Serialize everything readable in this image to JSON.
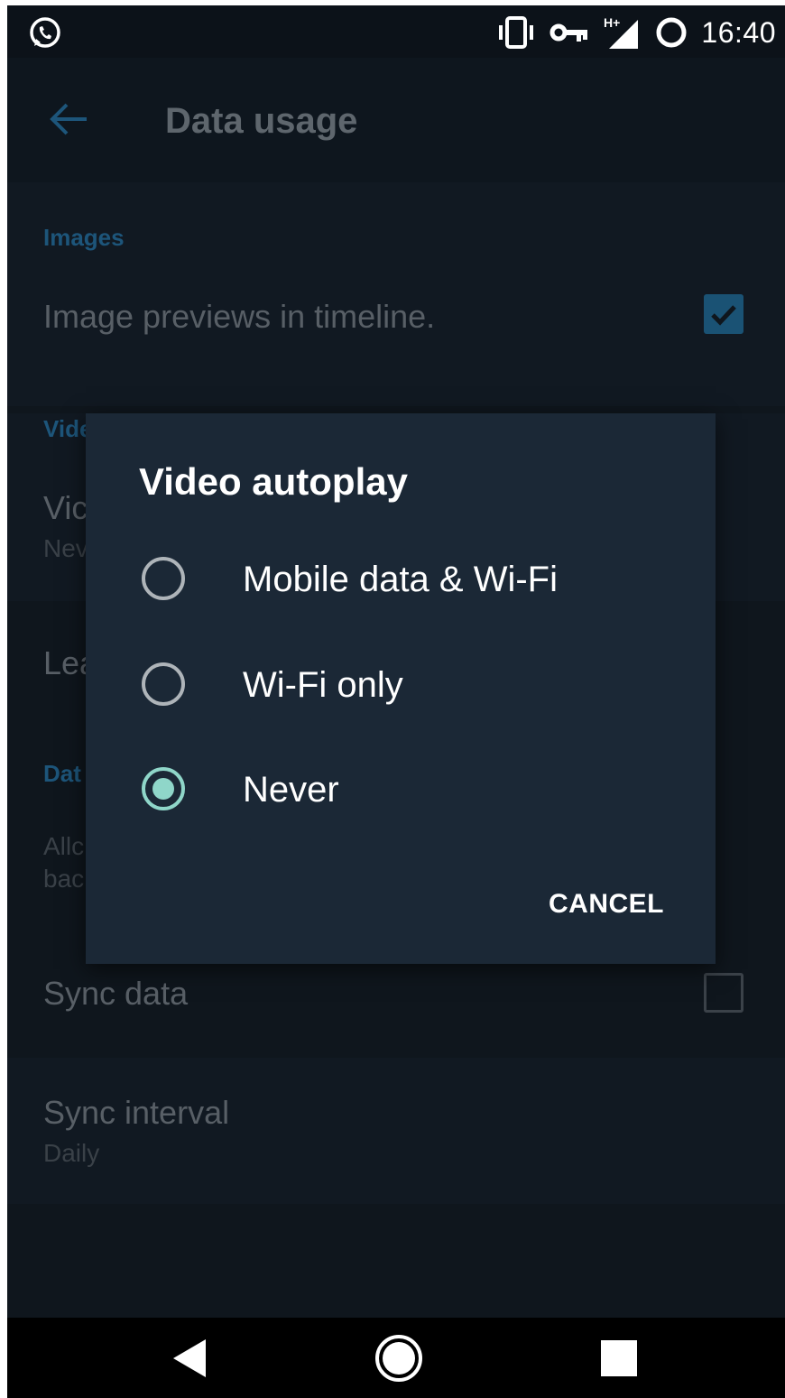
{
  "status_bar": {
    "time": "16:40",
    "icons": [
      "whatsapp-icon",
      "vibrate-icon",
      "vpn-key-icon",
      "signal-hplus-icon",
      "sync-icon"
    ],
    "network_label": "H+"
  },
  "app_bar": {
    "title": "Data usage",
    "back_icon": "arrow-left-icon"
  },
  "settings": {
    "images_header": "Images",
    "image_previews": {
      "label": "Image previews in timeline.",
      "checked": true
    },
    "videos_header_partial": "Vide",
    "video_autoplay_partial": {
      "label": "Vic",
      "value": "Nev"
    },
    "learn_partial": "Lea",
    "data_header_partial": "Dat",
    "allow_background_partial": {
      "line1": "Allc",
      "line2": "bac"
    },
    "sync_data": {
      "label": "Sync data",
      "checked": false
    },
    "sync_interval": {
      "label": "Sync interval",
      "value": "Daily"
    }
  },
  "dialog": {
    "title": "Video autoplay",
    "options": [
      {
        "label": "Mobile data & Wi-Fi",
        "selected": false
      },
      {
        "label": "Wi-Fi only",
        "selected": false
      },
      {
        "label": "Never",
        "selected": true
      }
    ],
    "cancel_label": "CANCEL"
  },
  "nav_bar": {
    "icons": [
      "back-triangle-icon",
      "home-circle-icon",
      "recents-square-icon"
    ]
  },
  "colors": {
    "accent": "#8fd6c9",
    "link_blue": "#1d557a",
    "dialog_bg": "#1b2836",
    "screen_bg": "#0f161d"
  }
}
